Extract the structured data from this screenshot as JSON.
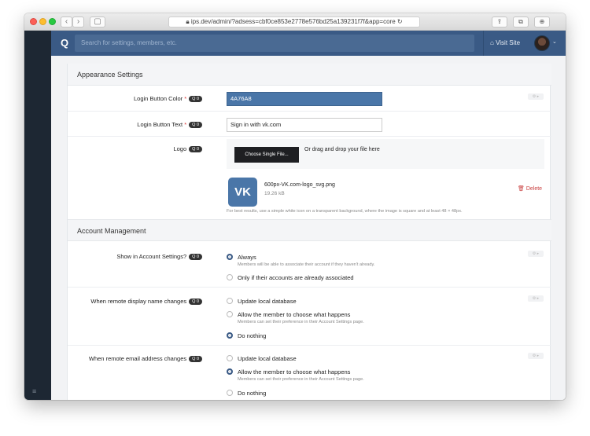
{
  "browser": {
    "url_host": "ips.dev",
    "url_path": "/admin/?adsess=cbf0ce853e2778e576bd25a139231f7f&app=core",
    "url_fade": "&app=core"
  },
  "topbar": {
    "search_placeholder": "Search for settings, members, etc.",
    "visit_site": "Visit Site"
  },
  "sections": {
    "appearance": "Appearance Settings",
    "account": "Account Management"
  },
  "fields": {
    "button_color": {
      "label": "Login Button Color",
      "required": "*",
      "badge": "0",
      "value": "4A76A8"
    },
    "button_text": {
      "label": "Login Button Text",
      "required": "*",
      "badge": "0",
      "value": "Sign in with vk.com"
    },
    "logo": {
      "label": "Logo",
      "badge": "0",
      "choose": "Choose Single File...",
      "drop_text": "Or drag and drop your file here",
      "file_name": "600px-VK.com-logo_svg.png",
      "file_size": "19.26 kB",
      "delete": "Delete",
      "hint": "For best results, use a simple white icon on a transparent background, where the image is square and at least 48 × 48px.",
      "logo_glyph": "VK"
    },
    "show_in_account": {
      "label": "Show in Account Settings?",
      "badge": "0",
      "opt1": "Always",
      "opt1_sub": "Members will be able to associate their account if they haven't already.",
      "opt2": "Only if their accounts are already associated"
    },
    "display_name": {
      "label": "When remote display name changes",
      "badge": "0",
      "opt1": "Update local database",
      "opt2": "Allow the member to choose what happens",
      "opt2_sub": "Members can set their preference in their Account Settings page.",
      "opt3": "Do nothing"
    },
    "email": {
      "label": "When remote email address changes",
      "badge": "0",
      "opt1": "Update local database",
      "opt2": "Allow the member to choose what happens",
      "opt2_sub": "Members can set their preference in their Account Settings page.",
      "opt3": "Do nothing"
    }
  },
  "colors": {
    "brand": "#3a5a85",
    "button_color": "#4a76a8",
    "sidebar": "#1d2733"
  }
}
